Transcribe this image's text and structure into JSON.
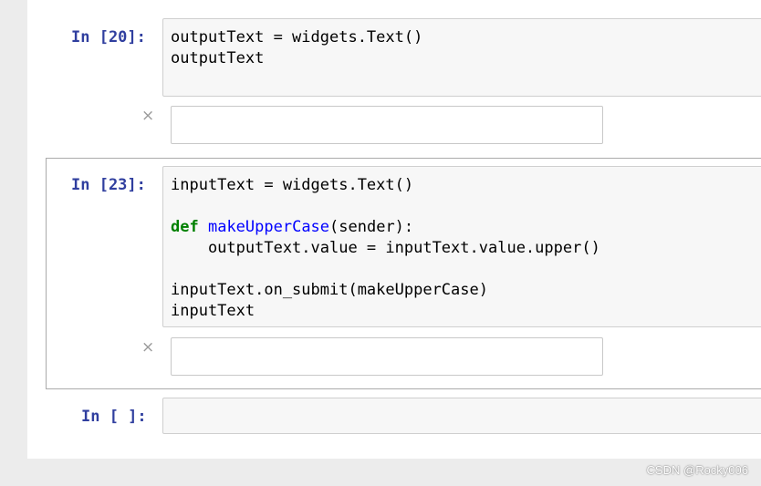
{
  "cells": [
    {
      "prompt": "In [20]:",
      "code_lines": [
        "outputText = widgets.Text()",
        "outputText"
      ],
      "output_close": "×",
      "output_widget_value": ""
    },
    {
      "prompt": "In [23]:",
      "code_lines": [
        "inputText = widgets.Text()",
        "",
        "def makeUpperCase(sender):",
        "    outputText.value = inputText.value.upper()",
        "",
        "inputText.on_submit(makeUpperCase)",
        "inputText"
      ],
      "output_close": "×",
      "output_widget_value": ""
    },
    {
      "prompt": "In [ ]:",
      "code_lines": [
        ""
      ]
    }
  ],
  "cell2_tokens": {
    "def_keyword": "def",
    "function_name": "makeUpperCase",
    "function_rest": "(sender):"
  },
  "watermark": "CSDN @Rocky006",
  "colors": {
    "prompt": "#303f9f",
    "keyword": "#008000",
    "function_name": "#0000ff",
    "input_bg": "#f7f7f7",
    "page_bg": "#ececec"
  }
}
